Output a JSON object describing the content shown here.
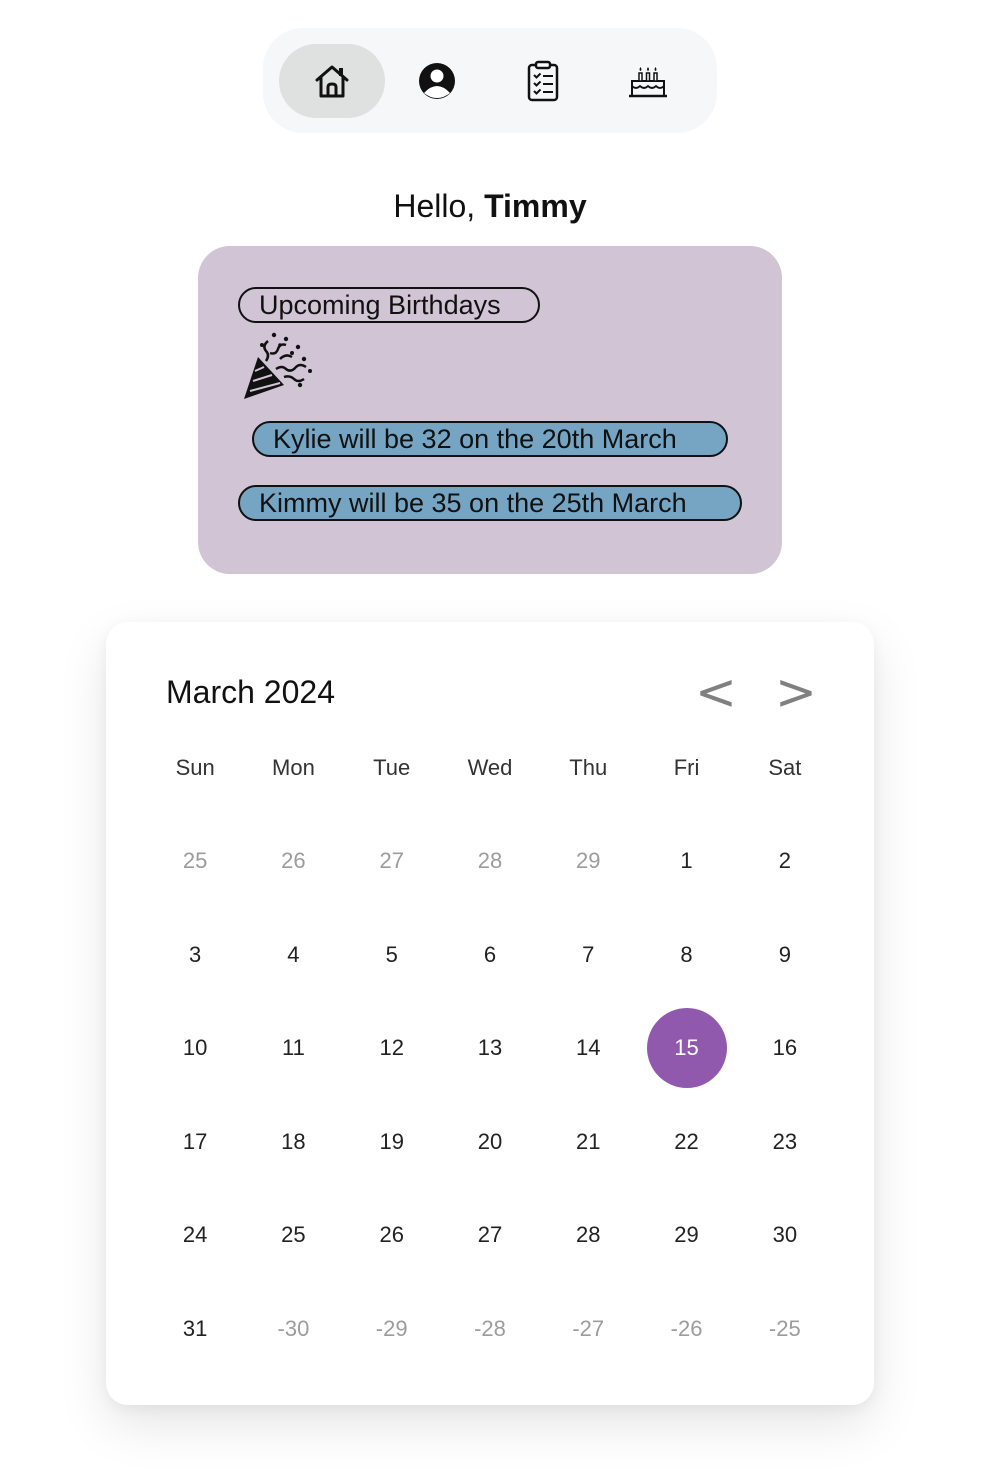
{
  "nav": {
    "items": [
      {
        "name": "home-icon",
        "active": true
      },
      {
        "name": "profile-icon",
        "active": false
      },
      {
        "name": "checklist-icon",
        "active": false
      },
      {
        "name": "birthday-cake-icon",
        "active": false
      }
    ]
  },
  "greeting": {
    "prefix": "Hello, ",
    "name": "Timmy"
  },
  "birthdays": {
    "title": "Upcoming Birthdays",
    "icon": "party-popper-icon",
    "items": [
      "Kylie will be 32 on the 20th March",
      "Kimmy will be 35 on the 25th March"
    ],
    "background": "#d1c4d5",
    "pill_color": "#76a5c3"
  },
  "calendar": {
    "title": "March 2024",
    "prev_label": "<",
    "next_label": ">",
    "weekdays": [
      "Sun",
      "Mon",
      "Tue",
      "Wed",
      "Thu",
      "Fri",
      "Sat"
    ],
    "selected_day": "15",
    "accent": "#9159ad",
    "weeks": [
      [
        {
          "label": "25",
          "muted": true
        },
        {
          "label": "26",
          "muted": true
        },
        {
          "label": "27",
          "muted": true
        },
        {
          "label": "28",
          "muted": true
        },
        {
          "label": "29",
          "muted": true
        },
        {
          "label": "1",
          "muted": false
        },
        {
          "label": "2",
          "muted": false
        }
      ],
      [
        {
          "label": "3",
          "muted": false
        },
        {
          "label": "4",
          "muted": false
        },
        {
          "label": "5",
          "muted": false
        },
        {
          "label": "6",
          "muted": false
        },
        {
          "label": "7",
          "muted": false
        },
        {
          "label": "8",
          "muted": false
        },
        {
          "label": "9",
          "muted": false
        }
      ],
      [
        {
          "label": "10",
          "muted": false
        },
        {
          "label": "11",
          "muted": false
        },
        {
          "label": "12",
          "muted": false
        },
        {
          "label": "13",
          "muted": false
        },
        {
          "label": "14",
          "muted": false
        },
        {
          "label": "15",
          "muted": false
        },
        {
          "label": "16",
          "muted": false
        }
      ],
      [
        {
          "label": "17",
          "muted": false
        },
        {
          "label": "18",
          "muted": false
        },
        {
          "label": "19",
          "muted": false
        },
        {
          "label": "20",
          "muted": false
        },
        {
          "label": "21",
          "muted": false
        },
        {
          "label": "22",
          "muted": false
        },
        {
          "label": "23",
          "muted": false
        }
      ],
      [
        {
          "label": "24",
          "muted": false
        },
        {
          "label": "25",
          "muted": false
        },
        {
          "label": "26",
          "muted": false
        },
        {
          "label": "27",
          "muted": false
        },
        {
          "label": "28",
          "muted": false
        },
        {
          "label": "29",
          "muted": false
        },
        {
          "label": "30",
          "muted": false
        }
      ],
      [
        {
          "label": "31",
          "muted": false
        },
        {
          "label": "-30",
          "muted": true
        },
        {
          "label": "-29",
          "muted": true
        },
        {
          "label": "-28",
          "muted": true
        },
        {
          "label": "-27",
          "muted": true
        },
        {
          "label": "-26",
          "muted": true
        },
        {
          "label": "-25",
          "muted": true
        }
      ]
    ]
  }
}
